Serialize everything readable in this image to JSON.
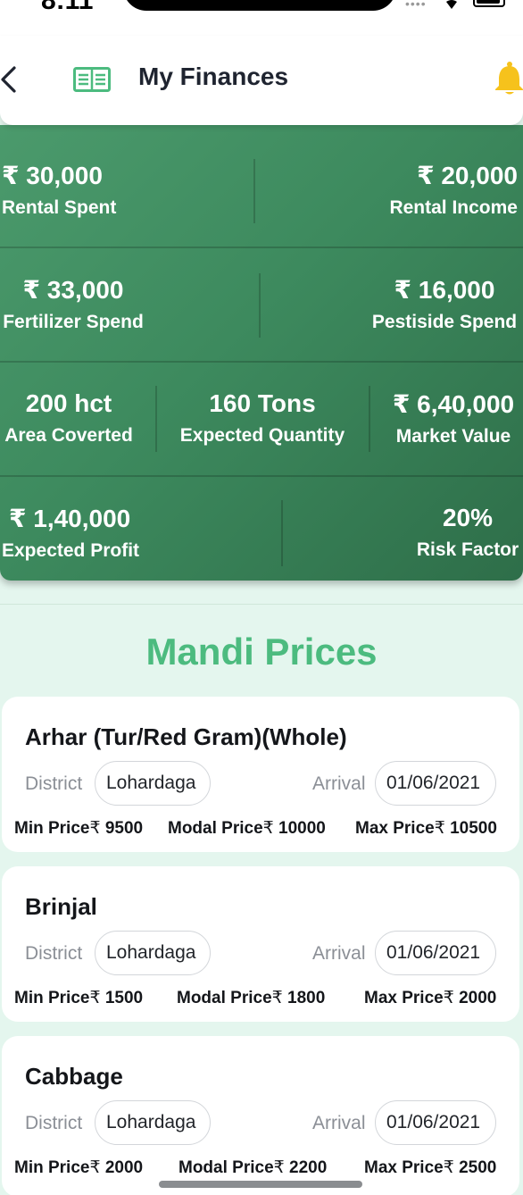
{
  "status": {
    "time": "8:11"
  },
  "header": {
    "title": "My Finances"
  },
  "stats": {
    "rental_spent": {
      "value": "₹ 30,000",
      "label": "Rental Spent"
    },
    "rental_income": {
      "value": "₹ 20,000",
      "label": "Rental Income"
    },
    "fertilizer_spend": {
      "value": "₹ 33,000",
      "label": "Fertilizer Spend"
    },
    "pestiside_spend": {
      "value": "₹ 16,000",
      "label": "Pestiside Spend"
    },
    "area_coverted": {
      "value": "200 hct",
      "label": "Area Coverted"
    },
    "expected_quantity": {
      "value": "160 Tons",
      "label": "Expected Quantity"
    },
    "market_value": {
      "value": "₹ 6,40,000",
      "label": "Market Value"
    },
    "expected_profit": {
      "value": "₹ 1,40,000",
      "label": "Expected Profit"
    },
    "risk_factor": {
      "value": "20%",
      "label": "Risk Factor"
    }
  },
  "mandi": {
    "title": "Mandi Prices",
    "district_label": "District",
    "arrival_label": "Arrival",
    "min_label": "Min Price",
    "modal_label": "Modal Price",
    "max_label": "Max Price",
    "currency": "₹",
    "items": [
      {
        "name": "Arhar (Tur/Red Gram)(Whole)",
        "district": "Lohardaga",
        "arrival": "01/06/2021",
        "min": "9500",
        "modal": "10000",
        "max": "10500"
      },
      {
        "name": "Brinjal",
        "district": "Lohardaga",
        "arrival": "01/06/2021",
        "min": "1500",
        "modal": "1800",
        "max": "2000"
      },
      {
        "name": "Cabbage",
        "district": "Lohardaga",
        "arrival": "01/06/2021",
        "min": "2000",
        "modal": "2200",
        "max": "2500"
      }
    ]
  },
  "colors": {
    "accent": "#4cbb7f",
    "card_green": "#3d8a5e",
    "bell": "#f6c21c"
  }
}
